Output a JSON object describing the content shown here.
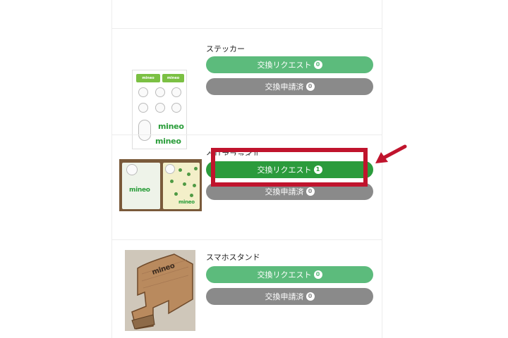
{
  "items": [
    {
      "name": "ステッカー",
      "request": {
        "label": "交換リクエスト",
        "count": "0"
      },
      "applied": {
        "label": "交換申請済",
        "count": "0"
      },
      "thumb_tags": [
        "mineo",
        "mineo"
      ],
      "thumb_logo": [
        "mineo",
        "mineo"
      ]
    },
    {
      "name": "クリアファイル",
      "request": {
        "label": "交換リクエスト",
        "count": "1"
      },
      "applied": {
        "label": "交換申請済",
        "count": "0"
      },
      "thumb_logo": [
        "mineo",
        "mineo"
      ]
    },
    {
      "name": "スマホスタンド",
      "request": {
        "label": "交換リクエスト",
        "count": "0"
      },
      "applied": {
        "label": "交換申請済",
        "count": "0"
      },
      "thumb_logo": "mineo"
    }
  ],
  "colors": {
    "request_button": "#5cbb7c",
    "request_button_highlighted": "#2b9b3c",
    "applied_button": "#8a8a8a",
    "annotation_red": "#c0142d"
  },
  "icons": [
    "red-arrow-icon"
  ]
}
